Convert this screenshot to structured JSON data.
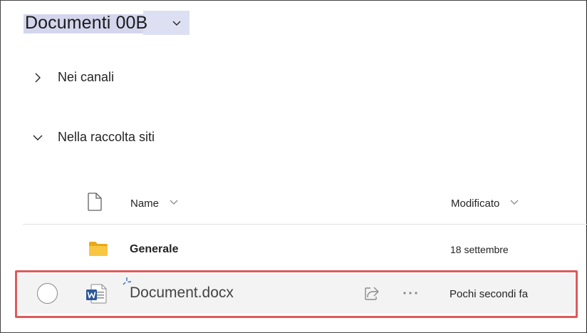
{
  "header": {
    "title": "Documenti 00B",
    "dropdown_icon": "chevron-down-icon"
  },
  "sections": [
    {
      "label": "Nei canali",
      "expanded": false,
      "icon": "chevron-right-icon"
    },
    {
      "label": "Nella raccolta siti",
      "expanded": true,
      "icon": "chevron-down-icon"
    }
  ],
  "columns": {
    "type_icon": "file-icon",
    "name": "Name",
    "modified": "Modificato",
    "sort_icon": "chevron-down-icon"
  },
  "rows": [
    {
      "type": "folder",
      "icon": "folder-icon",
      "name": "Generale",
      "modified": "18 settembre"
    },
    {
      "type": "word",
      "icon": "word-doc-icon",
      "name": "Document.docx",
      "modified": "Pochi secondi fa",
      "selected": false,
      "new": true
    }
  ],
  "colors": {
    "title_highlight": "#d3d6ec",
    "row_hover": "#f3f3f3",
    "highlight_border": "#e05a5a",
    "folder": "#f5c343",
    "word_blue": "#2b579a"
  }
}
